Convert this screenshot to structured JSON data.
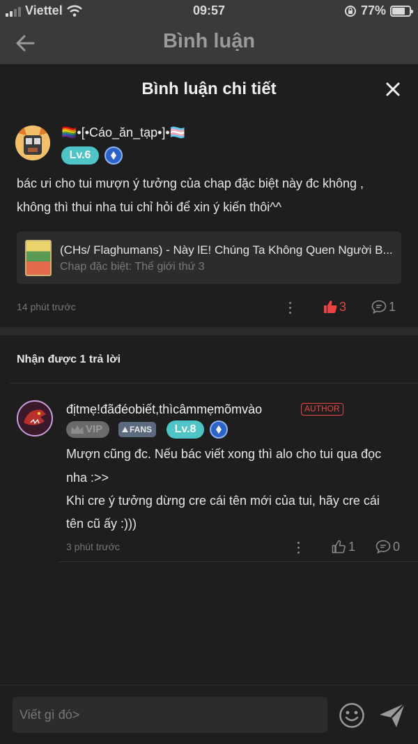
{
  "status_bar": {
    "carrier": "Viettel",
    "time": "09:57",
    "battery": "77%",
    "battery_level": 0.77
  },
  "app_bar": {
    "title": "Bình luận"
  },
  "sheet": {
    "title": "Bình luận chi tiết",
    "main_comment": {
      "username": "🏳️‍🌈•[•Cáo_ăn_tạp•]•🏳️‍⚧️",
      "level": "Lv.6",
      "lines": [
        "bác ưi cho tui mượn ý tưởng của chap đặc biệt này đc không ,",
        "không thì thui nha tui chỉ hỏi để xin ý kiến thôi^^"
      ],
      "chapter_card": {
        "title": "(CHs/ Flaghumans) - Này lE! Chúng Ta Không Quen Người B...",
        "subtitle": "Chap đặc biệt: Thế giới thứ 3"
      },
      "time": "14 phút trước",
      "likes": "3",
      "replies": "1",
      "accent_color": "#e94545"
    },
    "replies_heading": "Nhận được 1 trả lời",
    "reply": {
      "username": "địtmẹ!đãđéobiết,thìcâmmẹmõmvào",
      "author_badge": "AUTHOR",
      "vip_badge": "VIP",
      "fans_badge": "FANS",
      "level": "Lv.8",
      "lines": [
        "Mượn cũng đc. Nếu bác viết xong thì alo cho tui qua đọc",
        "nha :>>",
        "Khi cre ý tưởng dừng cre cái tên mới của tui, hãy cre cái",
        "tên cũ ấy :)))"
      ],
      "time": "3 phút trước",
      "likes": "1",
      "replies": "0"
    }
  },
  "composer": {
    "placeholder": "Viết gì đó>"
  }
}
